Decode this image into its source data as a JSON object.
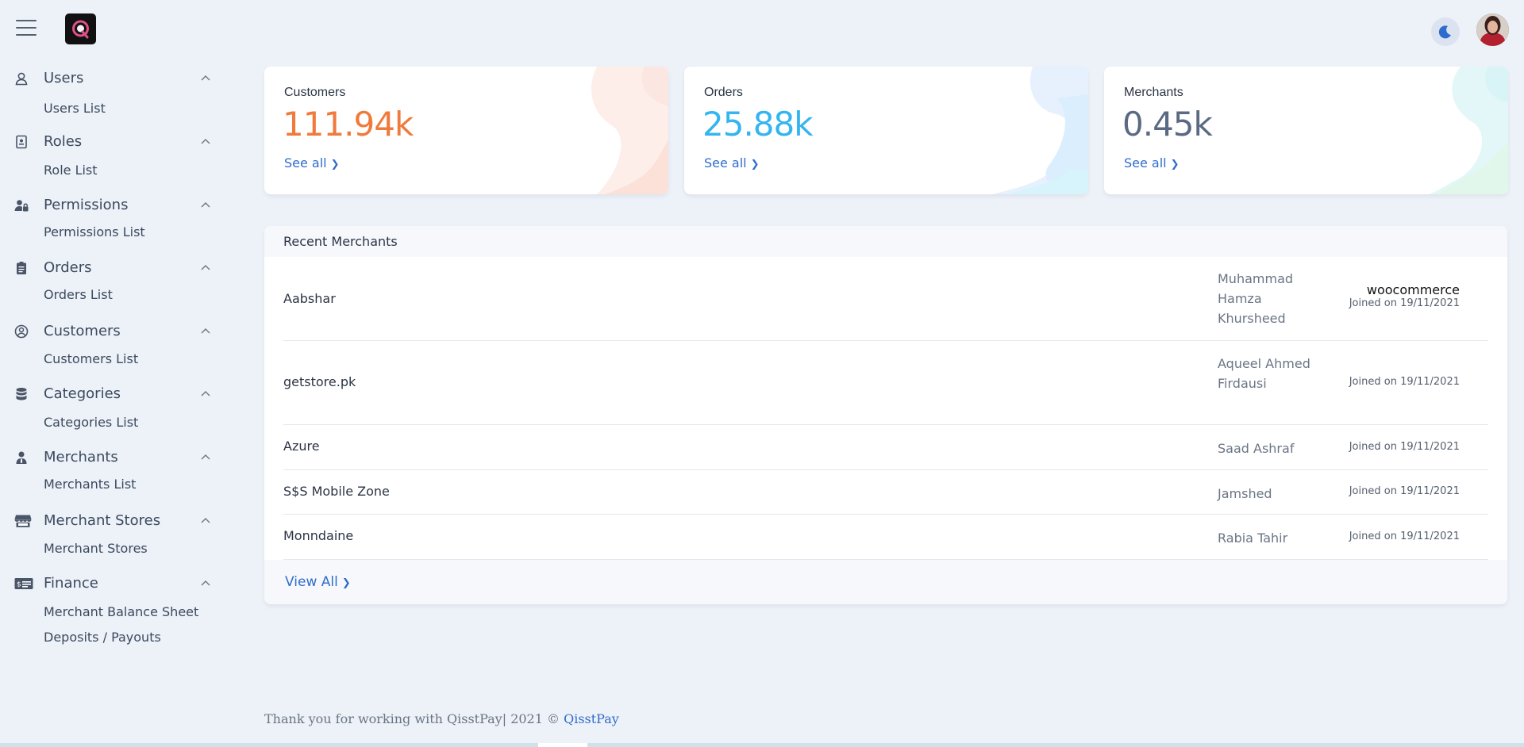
{
  "topbar": {
    "menu_icon": "hamburger-icon",
    "logo_icon": "qisstpay-logo",
    "theme_icon": "moon-icon",
    "avatar_icon": "user-avatar"
  },
  "sidebar": {
    "groups": [
      {
        "label": "Users",
        "icon": "user-icon",
        "items": [
          "Users List"
        ]
      },
      {
        "label": "Roles",
        "icon": "badge-icon",
        "items": [
          "Role List"
        ]
      },
      {
        "label": "Permissions",
        "icon": "user-lock-icon",
        "items": [
          "Permissions List"
        ]
      },
      {
        "label": "Orders",
        "icon": "clipboard-icon",
        "items": [
          "Orders List"
        ]
      },
      {
        "label": "Customers",
        "icon": "user-circle-icon",
        "items": [
          "Customers List"
        ]
      },
      {
        "label": "Categories",
        "icon": "database-icon",
        "items": [
          "Categories List"
        ]
      },
      {
        "label": "Merchants",
        "icon": "person-tie-icon",
        "items": [
          "Merchants List"
        ]
      },
      {
        "label": "Merchant Stores",
        "icon": "store-icon",
        "items": [
          "Merchant Stores"
        ]
      },
      {
        "label": "Finance",
        "icon": "money-check-icon",
        "items": [
          "Merchant Balance Sheet",
          "Deposits / Payouts"
        ]
      }
    ]
  },
  "stats": [
    {
      "title": "Customers",
      "value": "111.94k",
      "link": "See all",
      "color": "#f07a3c"
    },
    {
      "title": "Orders",
      "value": "25.88k",
      "link": "See all",
      "color": "#33b5f0"
    },
    {
      "title": "Merchants",
      "value": "0.45k",
      "link": "See all",
      "color": "#5a6a82"
    }
  ],
  "recent_merchants": {
    "title": "Recent Merchants",
    "rows": [
      {
        "name": "Aabshar",
        "owner": "Muhammad Hamza Khursheed",
        "platform": "woocommerce",
        "joined": "Joined on 19/11/2021"
      },
      {
        "name": "getstore.pk",
        "owner": "Aqueel Ahmed Firdausi",
        "platform": "",
        "joined": "Joined on 19/11/2021"
      },
      {
        "name": "Azure",
        "owner": "Saad Ashraf",
        "platform": "",
        "joined": "Joined on 19/11/2021"
      },
      {
        "name": "S$S Mobile Zone",
        "owner": "Jamshed",
        "platform": "",
        "joined": "Joined on 19/11/2021"
      },
      {
        "name": "Monndaine",
        "owner": "Rabia Tahir",
        "platform": "",
        "joined": "Joined on 19/11/2021"
      }
    ],
    "view_all": "View All"
  },
  "footer": {
    "text": "Thank you for working with QisstPay| 2021 ©",
    "brand": "QisstPay"
  }
}
